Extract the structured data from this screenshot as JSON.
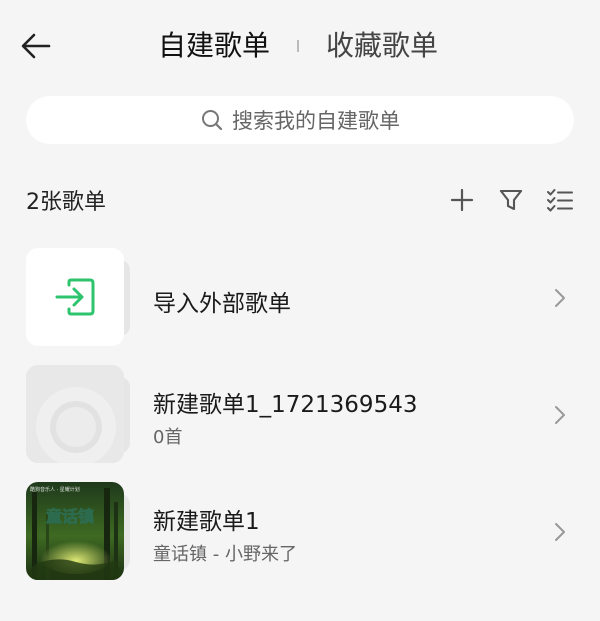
{
  "header": {
    "tabs": [
      {
        "label": "自建歌单",
        "active": true
      },
      {
        "label": "收藏歌单",
        "active": false
      }
    ]
  },
  "search": {
    "placeholder": "搜索我的自建歌单"
  },
  "list": {
    "count_label": "2张歌单",
    "items": [
      {
        "title": "导入外部歌单",
        "subtitle": "",
        "cover": "import-icon"
      },
      {
        "title": "新建歌单1_1721369543",
        "subtitle": "0首",
        "cover": "placeholder-disc"
      },
      {
        "title": "新建歌单1",
        "subtitle": "童话镇 - 小野来了",
        "cover": "album-art",
        "cover_text": "童话镇",
        "cover_caption": "酷狗音乐人 · 星耀计划"
      }
    ]
  },
  "colors": {
    "accent": "#2ec46e",
    "background": "#f5f5f5"
  }
}
